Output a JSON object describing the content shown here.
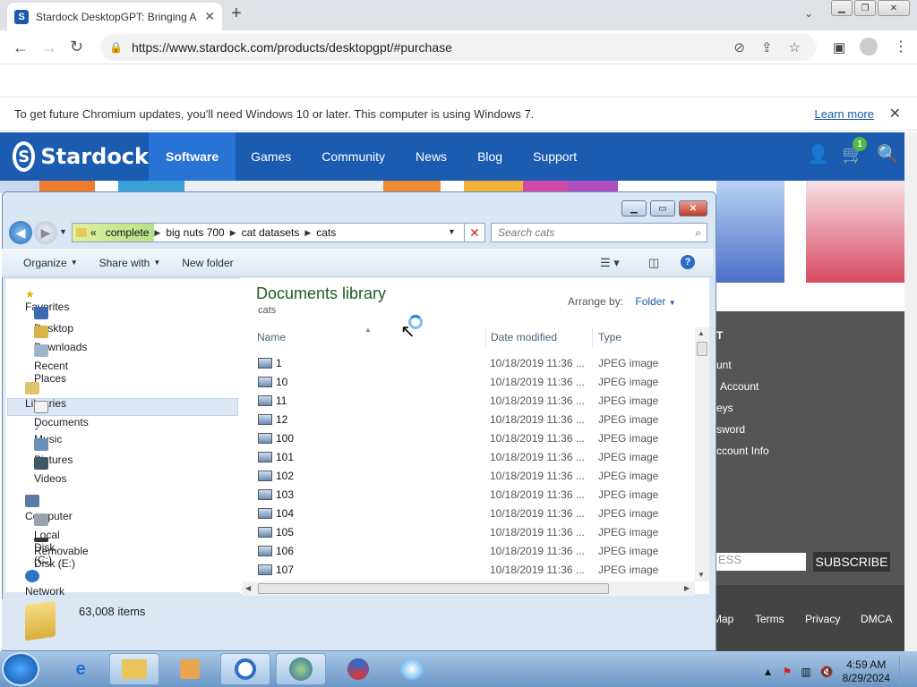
{
  "browser": {
    "tab_title": "Stardock DesktopGPT: Bringing A",
    "url": "https://www.stardock.com/products/desktopgpt/#purchase",
    "infobar_message": "To get future Chromium updates, you'll need Windows 10 or later. This computer is using Windows 7.",
    "infobar_link": "Learn more"
  },
  "site": {
    "logo": "Stardock",
    "nav": [
      "Software",
      "Games",
      "Community",
      "News",
      "Blog",
      "Support"
    ],
    "cart_count": "1",
    "side_links": [
      "T",
      "unt",
      "Account",
      "eys",
      "sword",
      "ccount Info"
    ],
    "subscribe_placeholder": "ESS",
    "subscribe_button": "SUBSCRIBE",
    "footer_links": [
      "Map",
      "Terms",
      "Privacy",
      "DMCA"
    ]
  },
  "explorer": {
    "breadcrumb": [
      "complete",
      "big nuts 700",
      "cat datasets",
      "cats"
    ],
    "breadcrumb_prefix": "«",
    "search_placeholder": "Search cats",
    "commands": [
      "Organize",
      "Share with",
      "New folder"
    ],
    "nav": {
      "favorites": "Favorites",
      "desktop": "Desktop",
      "downloads": "Downloads",
      "recent": "Recent Places",
      "libraries": "Libraries",
      "documents": "Documents",
      "music": "Music",
      "pictures": "Pictures",
      "videos": "Videos",
      "computer": "Computer",
      "local_disk": "Local Disk (C:)",
      "removable": "Removable Disk (E:)",
      "network": "Network"
    },
    "library_title": "Documents library",
    "library_sub": "cats",
    "arrange_label": "Arrange by:",
    "arrange_value": "Folder",
    "columns": [
      "Name",
      "Date modified",
      "Type"
    ],
    "rows": [
      {
        "name": "1",
        "date": "10/18/2019 11:36 ...",
        "type": "JPEG image"
      },
      {
        "name": "10",
        "date": "10/18/2019 11:36 ...",
        "type": "JPEG image"
      },
      {
        "name": "11",
        "date": "10/18/2019 11:36 ...",
        "type": "JPEG image"
      },
      {
        "name": "12",
        "date": "10/18/2019 11:36 ...",
        "type": "JPEG image"
      },
      {
        "name": "100",
        "date": "10/18/2019 11:36 ...",
        "type": "JPEG image"
      },
      {
        "name": "101",
        "date": "10/18/2019 11:36 ...",
        "type": "JPEG image"
      },
      {
        "name": "102",
        "date": "10/18/2019 11:36 ...",
        "type": "JPEG image"
      },
      {
        "name": "103",
        "date": "10/18/2019 11:36 ...",
        "type": "JPEG image"
      },
      {
        "name": "104",
        "date": "10/18/2019 11:36 ...",
        "type": "JPEG image"
      },
      {
        "name": "105",
        "date": "10/18/2019 11:36 ...",
        "type": "JPEG image"
      },
      {
        "name": "106",
        "date": "10/18/2019 11:36 ...",
        "type": "JPEG image"
      },
      {
        "name": "107",
        "date": "10/18/2019 11:36 ...",
        "type": "JPEG image"
      }
    ],
    "item_count": "63,008 items"
  },
  "taskbar": {
    "time": "4:59 AM",
    "date": "8/29/2024"
  }
}
